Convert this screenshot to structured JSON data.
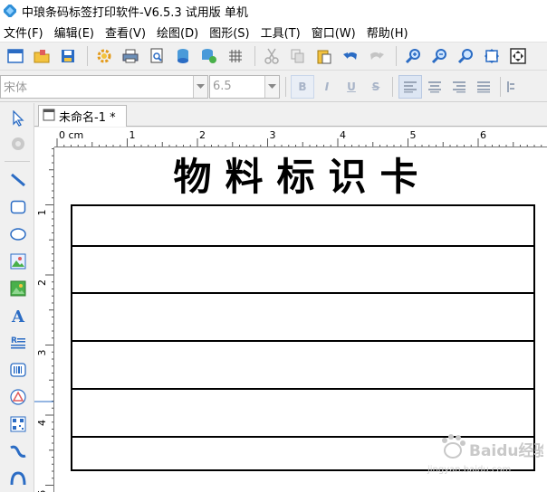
{
  "window": {
    "title": "中琅条码标签打印软件-V6.5.3 试用版 单机",
    "app_icon": "app-logo-icon"
  },
  "menu": {
    "items": [
      {
        "label": "文件(F)"
      },
      {
        "label": "编辑(E)"
      },
      {
        "label": "查看(V)"
      },
      {
        "label": "绘图(D)"
      },
      {
        "label": "图形(S)"
      },
      {
        "label": "工具(T)"
      },
      {
        "label": "窗口(W)"
      },
      {
        "label": "帮助(H)"
      }
    ]
  },
  "toolbar": {
    "icons": [
      "new-window-icon",
      "open-folder-icon",
      "save-icon",
      "settings-gear-icon",
      "print-icon",
      "print-preview-icon",
      "database-icon",
      "database-settings-icon",
      "grid-icon",
      "cut-icon",
      "copy-icon",
      "paste-icon",
      "undo-icon",
      "redo-icon",
      "zoom-in-icon",
      "zoom-out-icon",
      "zoom-custom-icon",
      "fit-page-icon",
      "actual-size-icon"
    ]
  },
  "format_bar": {
    "font_name": "宋体",
    "font_size": "6.5",
    "bold": "B",
    "italic": "I",
    "underline": "U",
    "strikethrough": "S"
  },
  "document": {
    "tab_label": "未命名-1 *",
    "ruler_unit": "cm",
    "h_ruler_labels": [
      "0 cm",
      "1",
      "2",
      "3",
      "4",
      "5",
      "6"
    ],
    "v_ruler_labels": [
      "1",
      "2",
      "3",
      "4",
      "5"
    ]
  },
  "label": {
    "title": "物料标识卡",
    "row_count": 6
  },
  "watermark": {
    "text": "Baidu经验",
    "subtext": "jingyan.baidu.com"
  },
  "colors": {
    "accent": "#2b6cc4",
    "ruler_line": "#777777"
  }
}
